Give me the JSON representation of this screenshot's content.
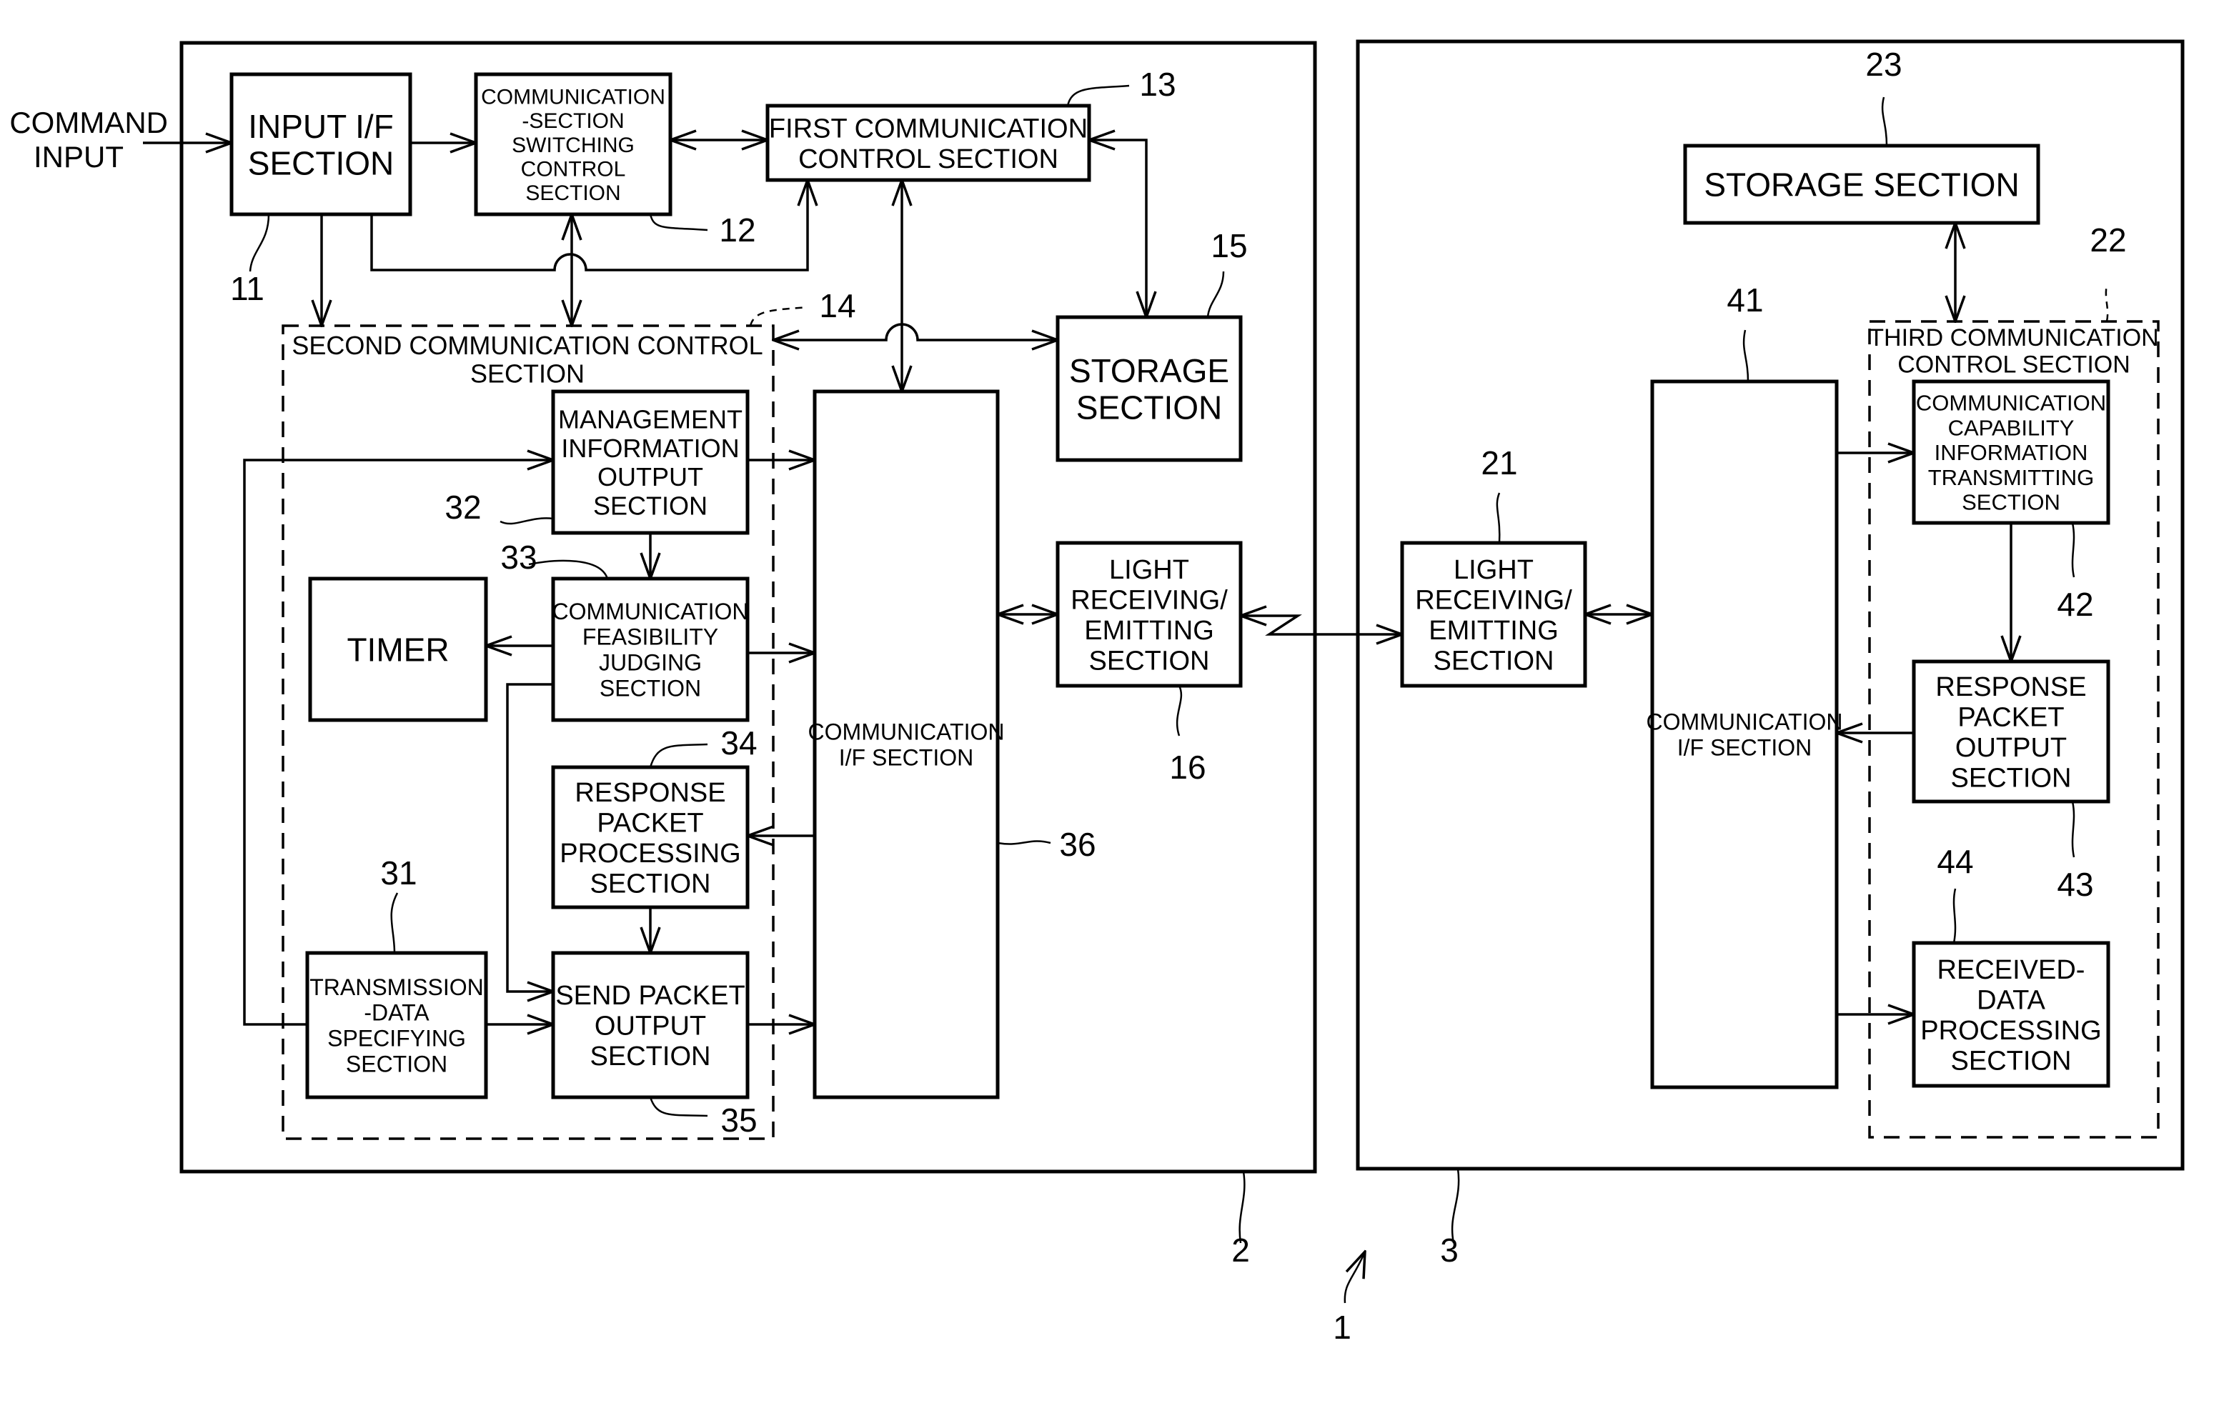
{
  "figure": {
    "system_ref": "1",
    "command_input": [
      "COMMAND",
      "INPUT"
    ],
    "left_unit": {
      "ref": "2",
      "input_if": {
        "ref": "11",
        "lines": [
          "INPUT I/F",
          "SECTION"
        ]
      },
      "switching": {
        "ref": "12",
        "lines": [
          "COMMUNICATION",
          "-SECTION",
          "SWITCHING",
          "CONTROL",
          "SECTION"
        ]
      },
      "first_comm": {
        "ref": "13",
        "lines": [
          "FIRST COMMUNICATION",
          "CONTROL SECTION"
        ]
      },
      "second_comm": {
        "ref": "14",
        "lines": [
          "SECOND COMMUNICATION CONTROL",
          "SECTION"
        ]
      },
      "storage": {
        "ref": "15",
        "lines": [
          "STORAGE",
          "SECTION"
        ]
      },
      "light": {
        "ref": "16",
        "lines": [
          "LIGHT",
          "RECEIVING/",
          "EMITTING",
          "SECTION"
        ]
      },
      "transmission_data": {
        "ref": "31",
        "lines": [
          "TRANSMISSION",
          "-DATA",
          "SPECIFYING",
          "SECTION"
        ]
      },
      "management_info": {
        "ref": "32",
        "lines": [
          "MANAGEMENT",
          "INFORMATION",
          "OUTPUT",
          "SECTION"
        ]
      },
      "feasibility": {
        "ref": "33",
        "lines": [
          "COMMUNICATION",
          "FEASIBILITY",
          "JUDGING",
          "SECTION"
        ]
      },
      "response_proc": {
        "ref": "34",
        "lines": [
          "RESPONSE",
          "PACKET",
          "PROCESSING",
          "SECTION"
        ]
      },
      "send_packet": {
        "ref": "35",
        "lines": [
          "SEND PACKET",
          "OUTPUT",
          "SECTION"
        ]
      },
      "comm_if": {
        "ref": "36",
        "lines": [
          "COMMUNICATION",
          "I/F SECTION"
        ]
      },
      "timer": {
        "lines": [
          "TIMER"
        ]
      }
    },
    "right_unit": {
      "ref": "3",
      "light": {
        "ref": "21",
        "lines": [
          "LIGHT",
          "RECEIVING/",
          "EMITTING",
          "SECTION"
        ]
      },
      "third_comm": {
        "ref": "22",
        "lines": [
          "THIRD COMMUNICATION",
          "CONTROL SECTION"
        ]
      },
      "storage": {
        "ref": "23",
        "lines": [
          "STORAGE SECTION"
        ]
      },
      "comm_if": {
        "ref": "41",
        "lines": [
          "COMMUNICATION",
          "I/F SECTION"
        ]
      },
      "capability": {
        "ref": "42",
        "lines": [
          "COMMUNICATION",
          "CAPABILITY",
          "INFORMATION",
          "TRANSMITTING",
          "SECTION"
        ]
      },
      "response_out": {
        "ref": "43",
        "lines": [
          "RESPONSE",
          "PACKET",
          "OUTPUT",
          "SECTION"
        ]
      },
      "received_data": {
        "ref": "44",
        "lines": [
          "RECEIVED-",
          "DATA",
          "PROCESSING",
          "SECTION"
        ]
      }
    }
  }
}
